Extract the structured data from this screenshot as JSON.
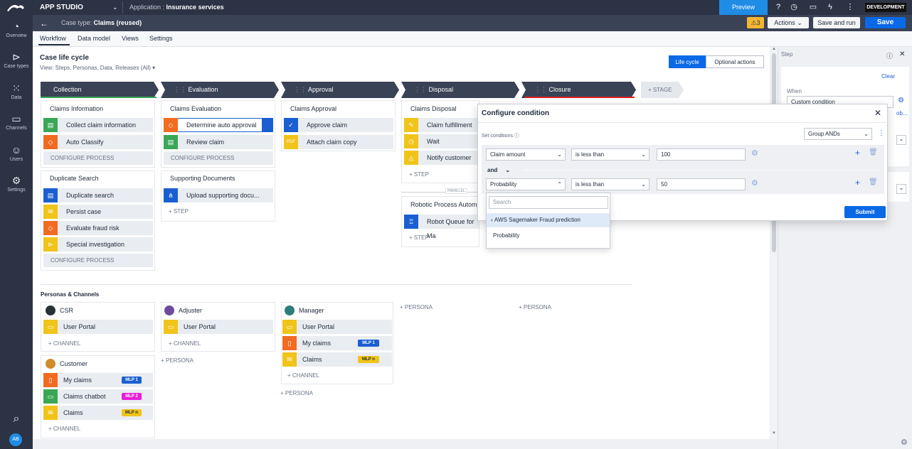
{
  "topbar": {
    "app_name": "APP STUDIO",
    "application_label": "Application :",
    "application_name": "Insurance services",
    "preview": "Preview",
    "environment": "DEVELOPMENT"
  },
  "casebar": {
    "case_type_label": "Case type:",
    "case_type_name": "Claims (reused)",
    "warning_count": "3",
    "actions": "Actions",
    "save_and_run": "Save and run",
    "save": "Save"
  },
  "leftnav": {
    "items": [
      {
        "label": "Overview"
      },
      {
        "label": "Case types"
      },
      {
        "label": "Data"
      },
      {
        "label": "Channels"
      },
      {
        "label": "Users"
      },
      {
        "label": "Settings"
      }
    ],
    "avatar": "AB"
  },
  "tabs": [
    "Workflow",
    "Data model",
    "Views",
    "Settings"
  ],
  "lifecycle": {
    "title": "Case life cycle",
    "view": "View: Steps, Personas, Data, Releases (All)",
    "lifecycle_btn": "Life cycle",
    "optional_btn": "Optional actions",
    "add_stage": "+ STAGE",
    "stages": [
      "Collection",
      "Evaluation",
      "Approval",
      "Disposal",
      "Closure"
    ],
    "configure_process": "CONFIGURE PROCESS",
    "add_step": "+ STEP",
    "parallel": "PARALLEL",
    "processes": {
      "claims_information": {
        "title": "Claims Information",
        "steps": [
          "Collect claim information",
          "Auto Classify"
        ]
      },
      "duplicate_search": {
        "title": "Duplicate Search",
        "steps": [
          "Duplicate search",
          "Persist case",
          "Evaluate fraud risk",
          "Special investigation"
        ]
      },
      "claims_evaluation": {
        "title": "Claims Evaluation",
        "steps": [
          "Determine auto approval",
          "Review claim"
        ]
      },
      "supporting_documents": {
        "title": "Supporting Documents",
        "steps": [
          "Upload supporting docu..."
        ]
      },
      "claims_approval": {
        "title": "Claims Approval",
        "steps": [
          "Approve claim",
          "Attach claim copy"
        ]
      },
      "claims_disposal": {
        "title": "Claims Disposal",
        "steps": [
          "Claim fulfillment",
          "Wait",
          "Notify customer"
        ]
      },
      "rpa": {
        "title": "Robotic Process Autom",
        "steps": [
          "Robot Queue for Ma"
        ]
      }
    }
  },
  "personas": {
    "title": "Personas & Channels",
    "add_channel": "+ CHANNEL",
    "add_persona": "+ PERSONA",
    "csr": {
      "name": "CSR",
      "channels": [
        "User Portal"
      ]
    },
    "customer": {
      "name": "Customer",
      "channels": [
        {
          "label": "My claims",
          "badge": "MLP 1"
        },
        {
          "label": "Claims chatbot",
          "badge": "MLP 2"
        },
        {
          "label": "Claims",
          "badge": "MLP n"
        }
      ]
    },
    "adjuster": {
      "name": "Adjuster",
      "channels": [
        "User Portal"
      ]
    },
    "manager": {
      "name": "Manager",
      "channels": [
        {
          "label": "User Portal",
          "badge": ""
        },
        {
          "label": "My claims",
          "badge": "MLP 1"
        },
        {
          "label": "Claims",
          "badge": "MLP n"
        }
      ]
    }
  },
  "rightpanel": {
    "title": "Step",
    "clear": "Clear",
    "when_label": "When",
    "when_value": "Custom condition",
    "obscured": "ob..."
  },
  "modal": {
    "title": "Configure condition",
    "set_conditions": "Set conditions",
    "group": "Group ANDs",
    "and": "and",
    "submit": "Submit",
    "rows": [
      {
        "field": "Claim amount",
        "operator": "is less than",
        "value": "100"
      },
      {
        "field": "Probability",
        "operator": "is less than",
        "value": "50"
      }
    ],
    "dropdown": {
      "search_placeholder": "Search",
      "group": "AWS Sagemaker Fraud prediction",
      "option": "Probability"
    }
  },
  "colors": {
    "green": "#3aa757",
    "orange": "#f26b21",
    "yellow": "#f0c419",
    "blue": "#1a5fd1",
    "magenta": "#e61ed8",
    "accent": "#0a69e6",
    "stage": "#3a4256"
  }
}
